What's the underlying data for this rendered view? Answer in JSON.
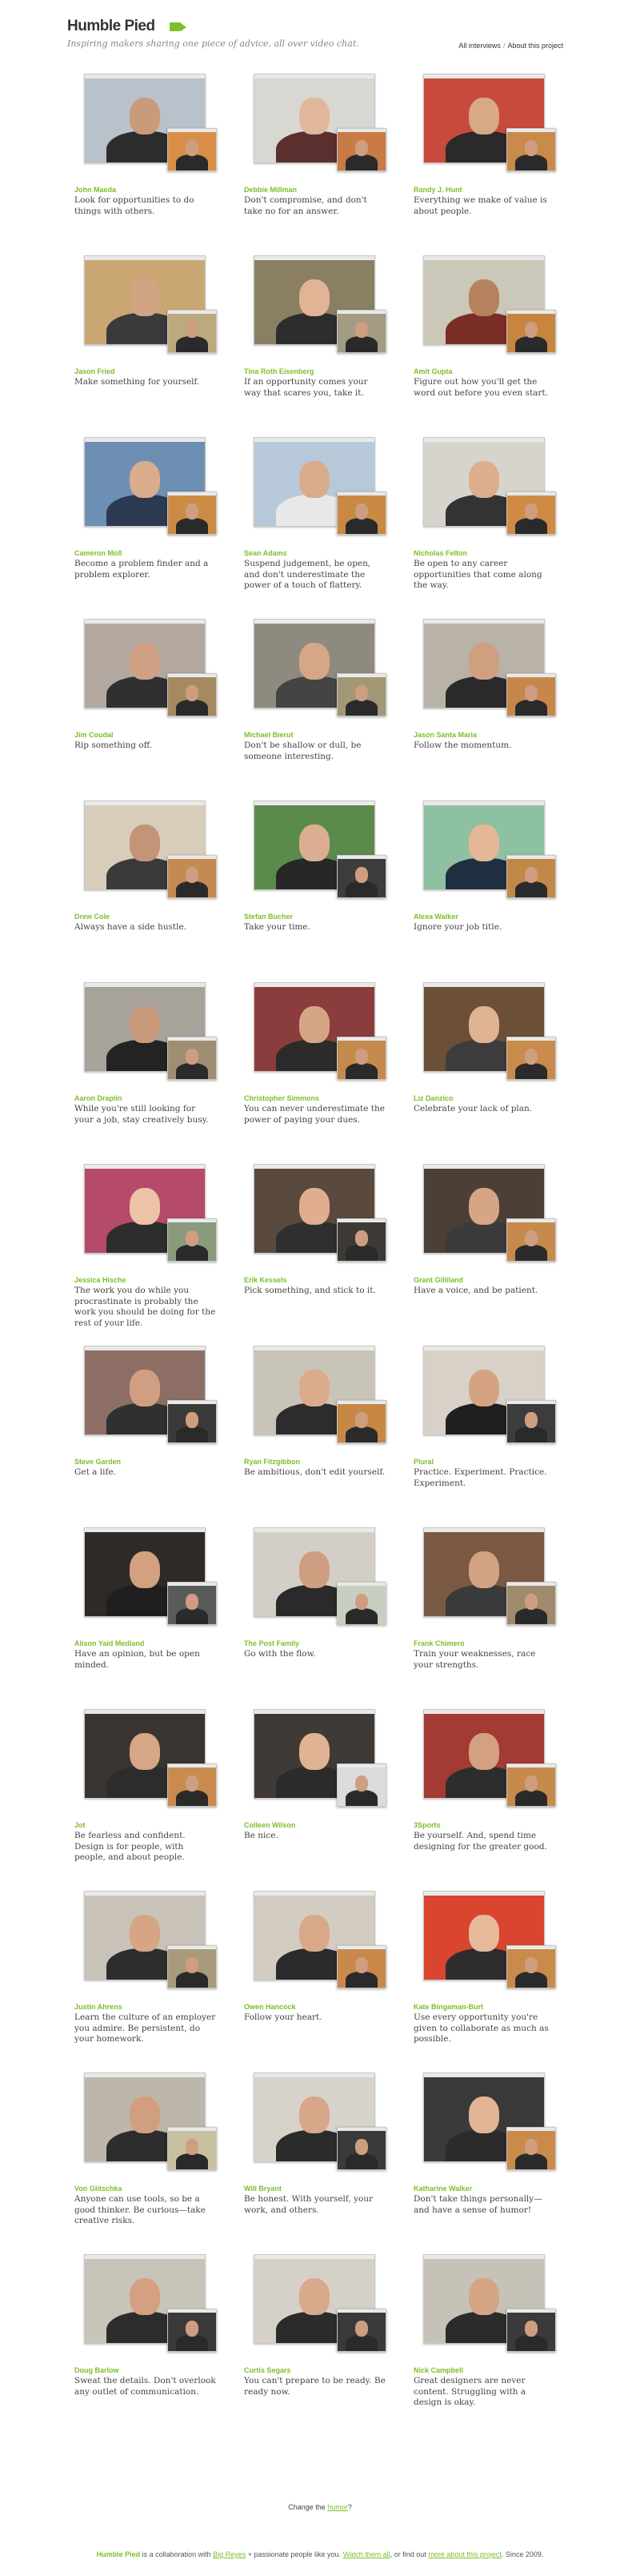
{
  "header": {
    "logo": "Humble Pied",
    "tagline": "Inspiring makers sharing one piece of advice, all over video chat.",
    "nav": [
      "All interviews",
      "About this project"
    ]
  },
  "interviews": [
    {
      "name": "John Maeda",
      "quote": "Look for opportunities to do things with others.",
      "scene": "#b9c2cb",
      "skin": "#c99b7a",
      "shirt": "#2c2c2c",
      "pip": "#d98f47"
    },
    {
      "name": "Debbie Millman",
      "quote": "Don't compromise, and don't take no for an answer.",
      "scene": "#d9d7d2",
      "skin": "#e1b79c",
      "shirt": "#5c2f2f",
      "pip": "#c97b46"
    },
    {
      "name": "Randy J. Hunt",
      "quote": "Everything we make of value is about people.",
      "scene": "#c84a3c",
      "skin": "#d8a887",
      "shirt": "#2a2a2a",
      "pip": "#c98a4a"
    },
    {
      "name": "Jason Fried",
      "quote": "Make something for yourself.",
      "scene": "#caa772",
      "skin": "#d0a584",
      "shirt": "#3a3a3a",
      "pip": "#bca97e"
    },
    {
      "name": "Tina Roth Eisenberg",
      "quote": "If an opportunity comes your way that scares you, take it.",
      "scene": "#8a7f63",
      "skin": "#e0b494",
      "shirt": "#2d2d2d",
      "pip": "#a39c82"
    },
    {
      "name": "Amit Gupta",
      "quote": "Figure out how you'll get the word out before you even start.",
      "scene": "#cbc7b9",
      "skin": "#b5825d",
      "shirt": "#7a2d25",
      "pip": "#c7853f"
    },
    {
      "name": "Cameron Moll",
      "quote": "Become a problem finder and a problem explorer.",
      "scene": "#6d8fb4",
      "skin": "#d9ad8c",
      "shirt": "#2c3a52",
      "pip": "#cc8b44"
    },
    {
      "name": "Sean Adams",
      "quote": "Suspend judgement, be open, and don't underestimate the power of a touch of flattery.",
      "scene": "#b7c9d8",
      "skin": "#d9ab8d",
      "shirt": "#e8e8e8",
      "pip": "#c98943"
    },
    {
      "name": "Nicholas Felton",
      "quote": "Be open to any career opportunities that come along the way.",
      "scene": "#d7d4cd",
      "skin": "#dcae8e",
      "shirt": "#333333",
      "pip": "#cf8b45"
    },
    {
      "name": "Jim Coudal",
      "quote": "Rip something off.",
      "scene": "#b3a8a0",
      "skin": "#cfa083",
      "shirt": "#303030",
      "pip": "#a58a60"
    },
    {
      "name": "Michael Bierut",
      "quote": "Don't be shallow or dull, be someone interesting.",
      "scene": "#8f8a80",
      "skin": "#d6a687",
      "shirt": "#444444",
      "pip": "#a39775"
    },
    {
      "name": "Jason Santa Maria",
      "quote": "Follow the momentum.",
      "scene": "#b9b2a6",
      "skin": "#cf9f80",
      "shirt": "#2a2a2a",
      "pip": "#c7874a"
    },
    {
      "name": "Drew Cole",
      "quote": "Always have a side hustle.",
      "scene": "#d8cdbb",
      "skin": "#c49478",
      "shirt": "#3a3a3a",
      "pip": "#c48a52"
    },
    {
      "name": "Stefan Bucher",
      "quote": "Take your time.",
      "scene": "#5b8a4d",
      "skin": "#dcae91",
      "shirt": "#272727",
      "pip": "#3d3d3d"
    },
    {
      "name": "Alexa Walker",
      "quote": "Ignore your job title.",
      "scene": "#8ec1a2",
      "skin": "#e3b798",
      "shirt": "#1f2f3f",
      "pip": "#c18848"
    },
    {
      "name": "Aaron Draplin",
      "quote": "While you're still looking for your a job, stay creatively busy.",
      "scene": "#a8a39a",
      "skin": "#c99a7b",
      "shirt": "#232323",
      "pip": "#9f8f72"
    },
    {
      "name": "Christopher Simmons",
      "quote": "You can never underestimate the power of paying your dues.",
      "scene": "#8b3d3d",
      "skin": "#d6a586",
      "shirt": "#2b2b2b",
      "pip": "#c48a4e"
    },
    {
      "name": "Liz Danzico",
      "quote": "Celebrate your lack of plan.",
      "scene": "#6b4f36",
      "skin": "#e0b393",
      "shirt": "#3c3c3c",
      "pip": "#c98b4b"
    },
    {
      "name": "Jessica Hische",
      "quote": "The work you do while you procrastinate is probably the work you should be doing for the rest of your life.",
      "scene": "#b54a6a",
      "skin": "#ecc3a6",
      "shirt": "#2d2d2d",
      "pip": "#8a9a7a"
    },
    {
      "name": "Erik Kessels",
      "quote": "Pick something, and stick to it.",
      "scene": "#5a4a3e",
      "skin": "#e0ad8f",
      "shirt": "#2f2f2f",
      "pip": "#3d3a36"
    },
    {
      "name": "Grant Gilliland",
      "quote": "Have a voice, and be patient.",
      "scene": "#4c3f36",
      "skin": "#d6a586",
      "shirt": "#3b3b3b",
      "pip": "#c78a4c"
    },
    {
      "name": "Steve Garden",
      "quote": "Get a life.",
      "scene": "#8d6e64",
      "skin": "#d09f81",
      "shirt": "#303030",
      "pip": "#3a3a3a"
    },
    {
      "name": "Ryan Fitzgibbon",
      "quote": "Be ambitious, don't edit yourself.",
      "scene": "#c8c4b8",
      "skin": "#dcab8c",
      "shirt": "#2c2c2c",
      "pip": "#c78745"
    },
    {
      "name": "Plural",
      "quote": "Practice. Experiment. Practice. Experiment.",
      "scene": "#d7d1c8",
      "skin": "#d5a384",
      "shirt": "#1f1f1f",
      "pip": "#3c3c3c"
    },
    {
      "name": "Alison Yaid Medland",
      "quote": "Have an opinion, but be open minded.",
      "scene": "#2f2a26",
      "skin": "#d3a080",
      "shirt": "#1f1f1f",
      "pip": "#5a5a5a"
    },
    {
      "name": "The Post Family",
      "quote": "Go with the flow.",
      "scene": "#d4cfc6",
      "skin": "#cf9e80",
      "shirt": "#2a2a2a",
      "pip": "#c7d0c0"
    },
    {
      "name": "Frank Chimero",
      "quote": "Train your weaknesses, race your strengths.",
      "scene": "#7a5a44",
      "skin": "#d3a283",
      "shirt": "#3a3a3a",
      "pip": "#a08a6c"
    },
    {
      "name": "Jot",
      "quote": "Be fearless and confident. Design is for people, with people, and about people.",
      "scene": "#3a3430",
      "skin": "#d6a687",
      "shirt": "#2c2c2c",
      "pip": "#c98c4e"
    },
    {
      "name": "Colleen Wilson",
      "quote": "Be nice.",
      "scene": "#403a36",
      "skin": "#e0b395",
      "shirt": "#2b2b2b",
      "pip": "#dcdcdc"
    },
    {
      "name": "3Sports",
      "quote": "Be yourself. And, spend time designing for the greater good.",
      "scene": "#a33a34",
      "skin": "#d3a182",
      "shirt": "#2d2d2d",
      "pip": "#c68a4b"
    },
    {
      "name": "Justin Ahrens",
      "quote": "Learn the culture of an employer you admire. Be persistent, do your homework.",
      "scene": "#c8c2b8",
      "skin": "#d6a586",
      "shirt": "#2d2d2d",
      "pip": "#a89a7c"
    },
    {
      "name": "Owen Hancock",
      "quote": "Follow your heart.",
      "scene": "#d2ccc2",
      "skin": "#d9a889",
      "shirt": "#2b2b2b",
      "pip": "#c9894a"
    },
    {
      "name": "Kate Bingaman-Burt",
      "quote": "Use every opportunity you're given to collaborate as much as possible.",
      "scene": "#d9452f",
      "skin": "#e6b99a",
      "shirt": "#2d2d2d",
      "pip": "#c98a4a"
    },
    {
      "name": "Von Glitschka",
      "quote": "Anyone can use tools, so be a good thinker. Be curious—take creative risks.",
      "scene": "#bdb6aa",
      "skin": "#d19f80",
      "shirt": "#2d2d2d",
      "pip": "#c9c0a0"
    },
    {
      "name": "Will Bryant",
      "quote": "Be honest. With yourself, your work, and others.",
      "scene": "#d8d3ca",
      "skin": "#d8a789",
      "shirt": "#2b2b2b",
      "pip": "#3a3a3a"
    },
    {
      "name": "Katharine Walker",
      "quote": "Don't take things personally—and have a sense of humor!",
      "scene": "#3a3a3a",
      "skin": "#e3b596",
      "shirt": "#2b2b2b",
      "pip": "#c98a4a"
    },
    {
      "name": "Doug Barlow",
      "quote": "Sweat the details. Don't overlook any outlet of communication.",
      "scene": "#c9c4ba",
      "skin": "#d3a182",
      "shirt": "#2c2c2c",
      "pip": "#3a3a3a"
    },
    {
      "name": "Curtis Segars",
      "quote": "You can't prepare to be ready. Be ready now.",
      "scene": "#d6d1c8",
      "skin": "#d8a98a",
      "shirt": "#2b2b2b",
      "pip": "#3a3a3a"
    },
    {
      "name": "Nick Campbell",
      "quote": "Great designers are never content. Struggling with a design is okay.",
      "scene": "#c7c2b8",
      "skin": "#d6a586",
      "shirt": "#2b2b2b",
      "pip": "#3a3a3a"
    }
  ],
  "footer": {
    "change_prefix": "Change the",
    "change_link": "humor",
    "change_suffix": "?",
    "brand": "Humble Pied",
    "text1": "is a collaboration with",
    "link1": "Big Reyes",
    "text2": "+ passionate people like you.",
    "link2": "Watch them all",
    "text3": ", or find out",
    "link3": "more about this project",
    "text4": ". Since 2009."
  }
}
